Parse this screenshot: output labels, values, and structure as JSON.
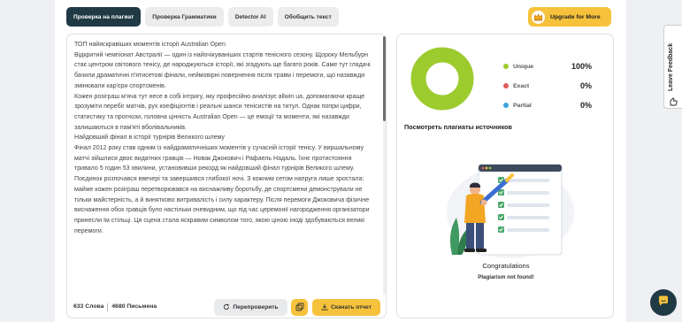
{
  "tabs": [
    {
      "label": "Проверка на плагиат",
      "active": true
    },
    {
      "label": "Проверка Грамматики",
      "active": false
    },
    {
      "label": "Detector AI",
      "active": false
    },
    {
      "label": "Обобщить текст",
      "active": false
    }
  ],
  "upgrade": {
    "label": "Upgrade for More",
    "icon": "crown-icon"
  },
  "editor": {
    "paragraphs": [
      "ТОП найяскравіших моментів історії Australian Open",
      "Відкритий чемпіонат Австралії — один із найочікуваніших стартів тенісного сезону. Щороку Мельбурн стає центром світового тенісу, де народжуються історії, які згадують ще багато років. Саме тут глядачі бачили драматичні п'ятисетові фінали, неймовірні повернення після травм і перемоги, що назавжди змінювали кар'єри спортсменів.",
      "Кожен розіграш м'яча тут несе в собі інтригу, яку професійно аналізує allwin ua, допомагаючи краще зрозуміти перебіг матчів, рух коефіцієнтів і реальні шанси тенісистів на титул. Однак попри цифри, статистику та прогнози, головна цінність Australian Open — це емоції та моменти, які назавжди залишаються в пам'яті вболівальників.",
      "Найдовший фінал в історії турнірів Великого шлему",
      "Фінал 2012 року став одним із найдраматичніших моментів у сучасній історії тенісу. У виршальному матчі зійшлися двоє видатних гравців — Новак Джокович і Рафаель Надаль. Їхнє протистояння тривало 5 годин 53 хвилини, установивши рекорд як найдовший фінал турнірів Великого шлему.",
      "Поєдинок розпочався ввечері та завершився глибокої ночі. З кожним сетом напруга лише зростала: майже кожен розіграш перетворювався на виснажливу боротьбу, де спортсмени демонстрували не тільки майстерність, а й винятково витривалість і силу характеру. Після перемоги Джоковича фізичне виснаження обох гравців було настільки очевидним, що під час церемонії нагородження організатори принесли їм стільці. Ця сцена стала яскравим символом того, якою ціною іноді здобуваються великі перемоги."
    ],
    "word_count": "633 Слова",
    "char_count": "4680 Письмена",
    "recheck_label": "Перепроверить",
    "download_label": "Скачать отчет"
  },
  "results": {
    "stats": [
      {
        "label": "Unique",
        "value": "100%",
        "color": "#9ccb2e"
      },
      {
        "label": "Exact",
        "value": "0%",
        "color": "#e05a5a"
      },
      {
        "label": "Partial",
        "value": "0%",
        "color": "#3aa3d8"
      }
    ],
    "donut_unique_fraction": 1.0,
    "sources_title": "Посмотреть плагиаты источников",
    "congrats": "Congratulations",
    "not_found": "Plagiarism not found!"
  },
  "feedback": {
    "label": "Leave Feedback"
  },
  "colors": {
    "accent": "#f7c23b",
    "dark": "#1f3a44",
    "unique": "#9ccb2e"
  }
}
